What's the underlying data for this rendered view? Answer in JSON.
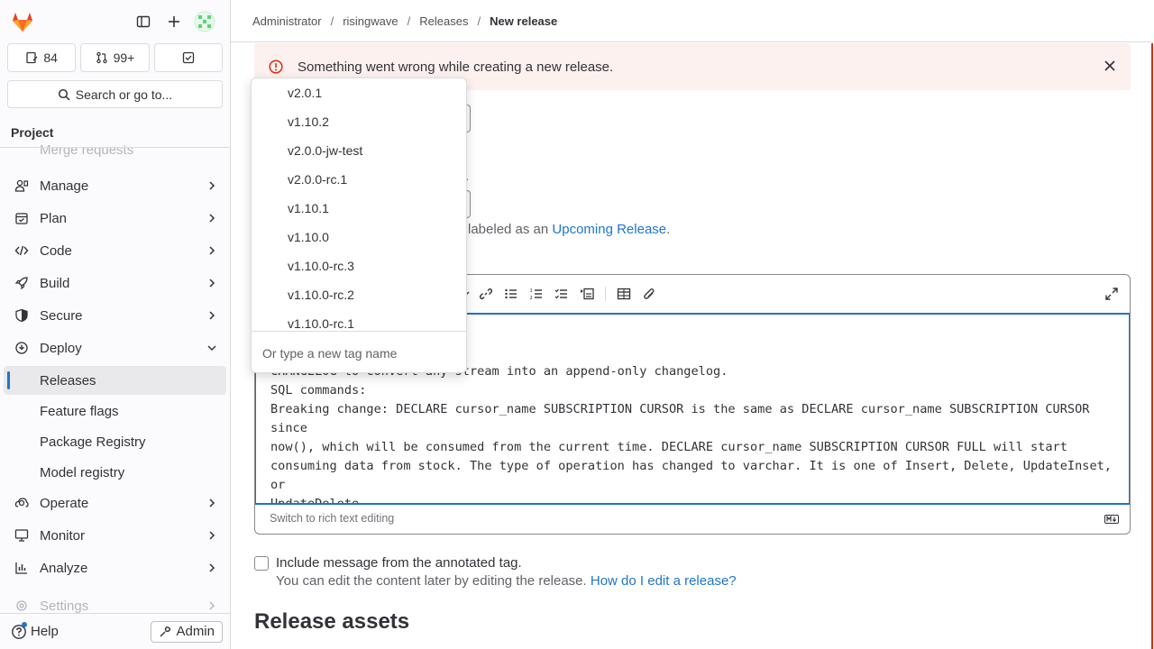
{
  "sidebar": {
    "counters": [
      {
        "icon": "issues-icon",
        "label": "84"
      },
      {
        "icon": "merge-request-icon",
        "label": "99+"
      },
      {
        "icon": "todo-icon",
        "label": ""
      }
    ],
    "search_label": "Search or go to...",
    "section_label": "Project",
    "faded_item": "Merge requests",
    "items": [
      {
        "label": "Manage",
        "icon": "users-icon"
      },
      {
        "label": "Plan",
        "icon": "calendar-icon"
      },
      {
        "label": "Code",
        "icon": "code-icon"
      },
      {
        "label": "Build",
        "icon": "rocket-icon"
      },
      {
        "label": "Secure",
        "icon": "shield-icon"
      },
      {
        "label": "Deploy",
        "icon": "deploy-icon"
      }
    ],
    "deploy_subitems": [
      "Releases",
      "Feature flags",
      "Package Registry",
      "Model registry"
    ],
    "items_after": [
      {
        "label": "Operate",
        "icon": "cloud-gear-icon"
      },
      {
        "label": "Monitor",
        "icon": "monitor-icon"
      },
      {
        "label": "Analyze",
        "icon": "chart-icon"
      }
    ],
    "settings_label": "Settings",
    "help_label": "Help",
    "admin_label": "Admin"
  },
  "breadcrumb": [
    "Administrator",
    "risingwave",
    "Releases",
    "New release"
  ],
  "alert": {
    "message": "Something went wrong while creating a new release."
  },
  "hint": {
    "prefix": "labeled as an ",
    "link": "Upcoming Release",
    "suffix": "."
  },
  "tag_dropdown": {
    "items": [
      "v2.0.1",
      "v1.10.2",
      "v2.0.0-jw-test",
      "v2.0.0-rc.1",
      "v1.10.1",
      "v1.10.0",
      "v1.10.0-rc.3",
      "v1.10.0-rc.2",
      "v1.10.0-rc.1"
    ],
    "new_tag_placeholder": "Or type a new tag name"
  },
  "editor": {
    "body_lines": [
      "CHANGELOG to convert any stream into an append-only changelog.",
      "SQL commands:",
      "Breaking change: DECLARE cursor_name SUBSCRIPTION CURSOR is the same as DECLARE cursor_name SUBSCRIPTION CURSOR since",
      "now(), which will be consumed from the current time. DECLARE cursor_name SUBSCRIPTION CURSOR FULL will start",
      "consuming data from stock. The type of operation has changed to varchar. It is one of Insert, Delete, UpdateInset, or",
      "UpdateDelete."
    ],
    "switch_label": "Switch to rich text editing"
  },
  "include_message": {
    "label": "Include message from the annotated tag.",
    "help_text": "You can edit the content later by editing the release. ",
    "help_link": "How do I edit a release?"
  },
  "section_title": "Release assets",
  "colors": {
    "accent": "#1f75cb",
    "danger": "#dd2b0e",
    "alert_bg": "#fcf1ef",
    "active_bg": "#e9e9eb"
  }
}
